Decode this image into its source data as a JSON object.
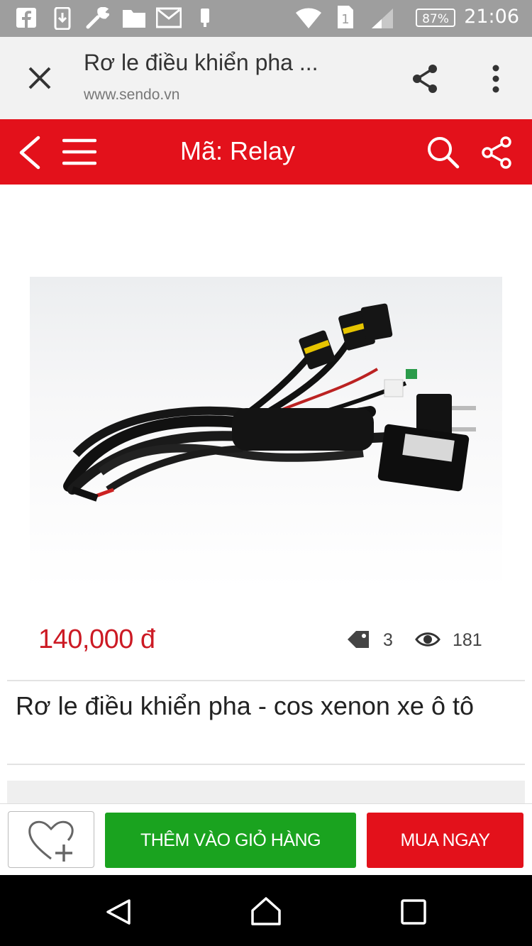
{
  "status_bar": {
    "battery": "87%",
    "time": "21:06",
    "sim_slot": "1",
    "icons": [
      "facebook-icon",
      "download-icon",
      "wrench-icon",
      "folder-icon",
      "gmail-icon",
      "device-icon",
      "wifi-icon",
      "sim-icon",
      "signal-icon",
      "battery-icon"
    ]
  },
  "custom_tab": {
    "title": "Rơ le điều khiển pha ...",
    "url": "www.sendo.vn"
  },
  "app_bar": {
    "title": "Mã: Relay",
    "color": "#e3111b"
  },
  "product": {
    "price": "140,000 đ",
    "tag_count": "3",
    "view_count": "181",
    "title": "Rơ le điều khiển pha - cos xenon xe ô tô",
    "price_color": "#cc1a24"
  },
  "actions": {
    "add_to_cart": "THÊM VÀO GIỎ HÀNG",
    "buy_now": "MUA NGAY",
    "add_to_cart_color": "#1aa31f",
    "buy_now_color": "#e3111b"
  }
}
